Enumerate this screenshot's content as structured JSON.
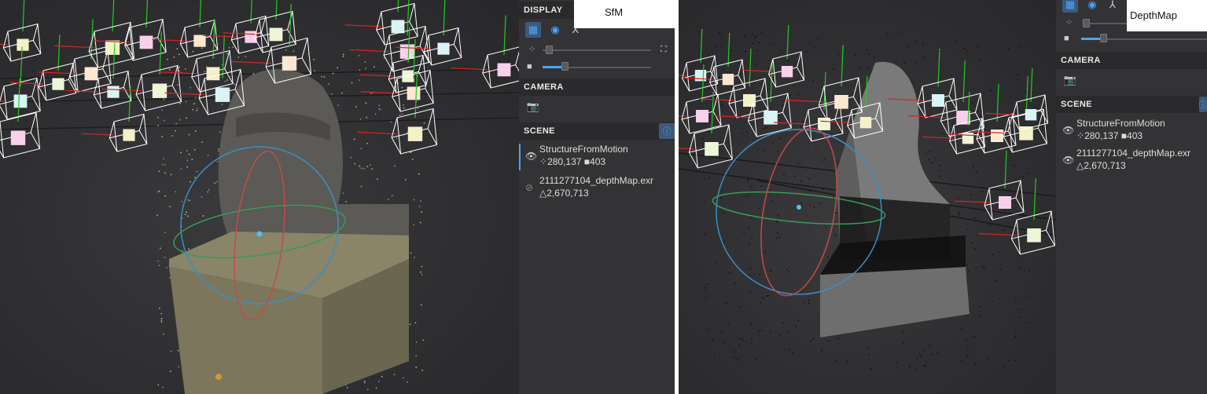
{
  "left": {
    "label": "SfM",
    "panel": {
      "display_header": "DISPLAY",
      "camera_header": "CAMERA",
      "scene_header": "SCENE"
    },
    "scene_items": [
      {
        "name": "StructureFromMotion",
        "points": "280,137",
        "cameras": "403",
        "visible": true,
        "selected": true
      },
      {
        "name": "2111277104_depthMap.exr",
        "triangles": "2,670,713",
        "visible": false,
        "selected": false
      }
    ]
  },
  "right": {
    "label": "DepthMap",
    "panel": {
      "camera_header": "CAMERA",
      "scene_header": "SCENE"
    },
    "scene_items": [
      {
        "name": "StructureFromMotion",
        "points": "280,137",
        "cameras": "403",
        "visible": true
      },
      {
        "name": "2111277104_depthMap.exr",
        "triangles": "2,670,713",
        "visible": true
      }
    ]
  },
  "icons": {
    "grid": "grid-icon",
    "gizmo": "target-icon",
    "figure": "figure-icon",
    "point_size": "points-icon",
    "camera_scale": "video-camera-icon",
    "fit": "fit-view-icon",
    "snapshot": "camera-snapshot-icon",
    "eye": "eye-icon",
    "eye_off": "eye-off-icon",
    "info": "info-icon"
  },
  "colors": {
    "accent": "#4aa3ff",
    "panel_bg": "#333335",
    "header_bg": "#2a2a2c",
    "viewport_bg": "#2f2f31",
    "camera_up": "#22cc22",
    "camera_axis": "#dd2222"
  }
}
